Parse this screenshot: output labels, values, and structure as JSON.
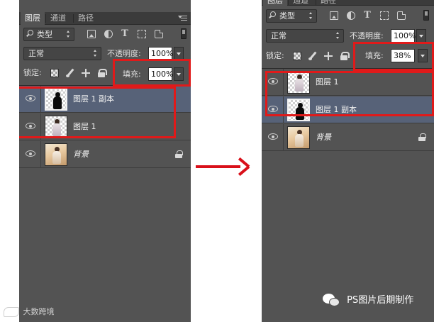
{
  "panels": [
    {
      "id": "before",
      "tabs": [
        "图层",
        "通道",
        "路径"
      ],
      "filter": {
        "label": "类型"
      },
      "blend_mode": "正常",
      "opacity": {
        "label": "不透明度:",
        "value": "100%"
      },
      "lock_label": "锁定:",
      "fill": {
        "label": "填充:",
        "value": "100%"
      },
      "layers": [
        {
          "name": "图层 1 副本",
          "thumb": "silhouette",
          "selected": true
        },
        {
          "name": "图层 1",
          "thumb": "photo",
          "selected": false
        },
        {
          "name": "背景",
          "thumb": "background",
          "selected": false,
          "locked": true
        }
      ]
    },
    {
      "id": "after",
      "tabs": [
        "图层",
        "通道",
        "路径"
      ],
      "filter": {
        "label": "类型"
      },
      "blend_mode": "正常",
      "opacity": {
        "label": "不透明度:",
        "value": "100%"
      },
      "lock_label": "锁定:",
      "fill": {
        "label": "填充:",
        "value": "38%"
      },
      "layers": [
        {
          "name": "图层 1",
          "thumb": "photo",
          "selected": false
        },
        {
          "name": "图层 1 副本",
          "thumb": "silhouette",
          "selected": true
        },
        {
          "name": "背景",
          "thumb": "background",
          "selected": false,
          "locked": true
        }
      ]
    }
  ],
  "watermarks": {
    "left": "大数跨境",
    "right": "PS图片后期制作"
  },
  "colors": {
    "panel_bg": "#535353",
    "selected_row": "#576278",
    "highlight": "#e01a1a",
    "arrow": "#d9101a"
  },
  "icons": {
    "visibility": "eye-icon",
    "search": "search-icon",
    "arrow": "right-arrow-icon",
    "lock": "lock-icon"
  }
}
